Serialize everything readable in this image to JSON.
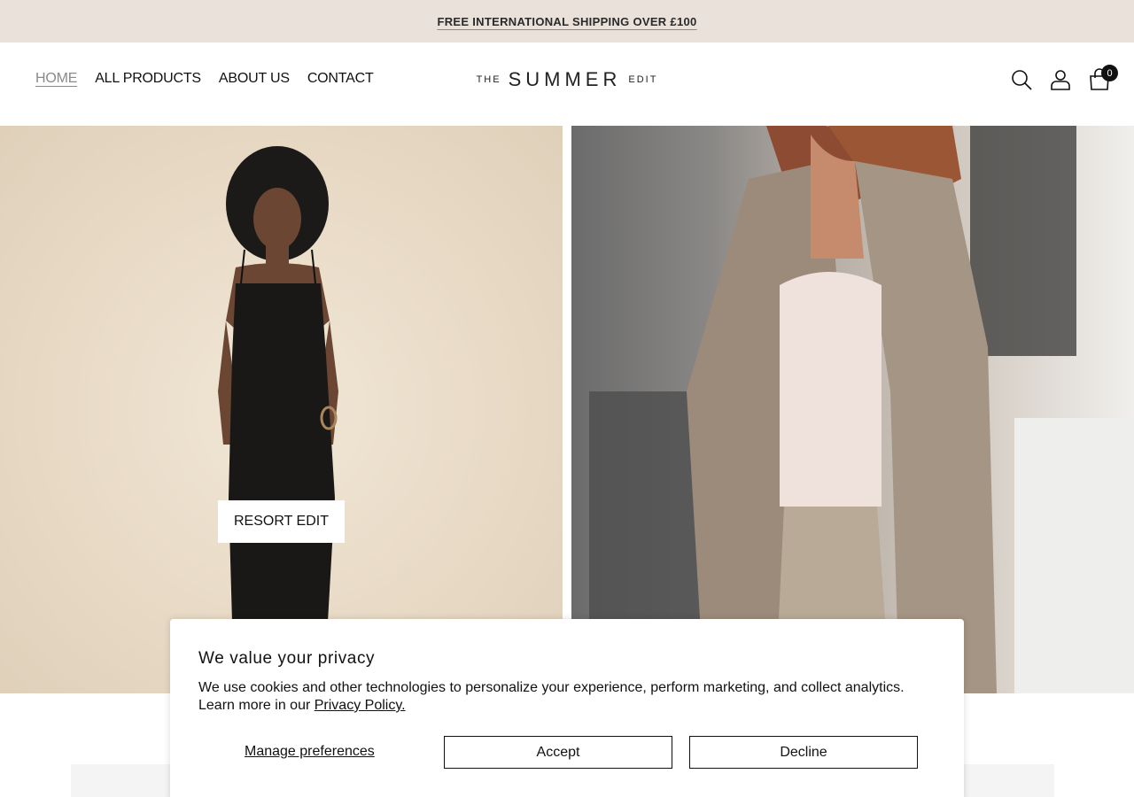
{
  "announcement": {
    "text": "FREE INTERNATIONAL SHIPPING OVER £100"
  },
  "nav": {
    "items": [
      {
        "label": "HOME",
        "active": true
      },
      {
        "label": "ALL PRODUCTS"
      },
      {
        "label": "ABOUT US"
      },
      {
        "label": "CONTACT"
      }
    ]
  },
  "logo": {
    "prefix": "THE",
    "main": "SUMMER",
    "suffix": "EDIT"
  },
  "header_icons": {
    "search": "search-icon",
    "account": "user-icon",
    "cart": "shopping-bag-icon",
    "cart_count": "0"
  },
  "hero": {
    "left_button": "RESORT EDIT",
    "left_image": "woman in black slip maxi dress on beige background",
    "right_image": "woman in taupe linen shirt and lounge pants"
  },
  "cookie_banner": {
    "title": "We value your privacy",
    "body": "We use cookies and other technologies to personalize your experience, perform marketing, and collect analytics. Learn more in our",
    "link": "Privacy Policy.",
    "manage": "Manage preferences",
    "accept": "Accept",
    "decline": "Decline"
  },
  "colors": {
    "announcement_bg": "#e9e1da",
    "text": "#111111",
    "active_nav": "#8a8a8a"
  }
}
